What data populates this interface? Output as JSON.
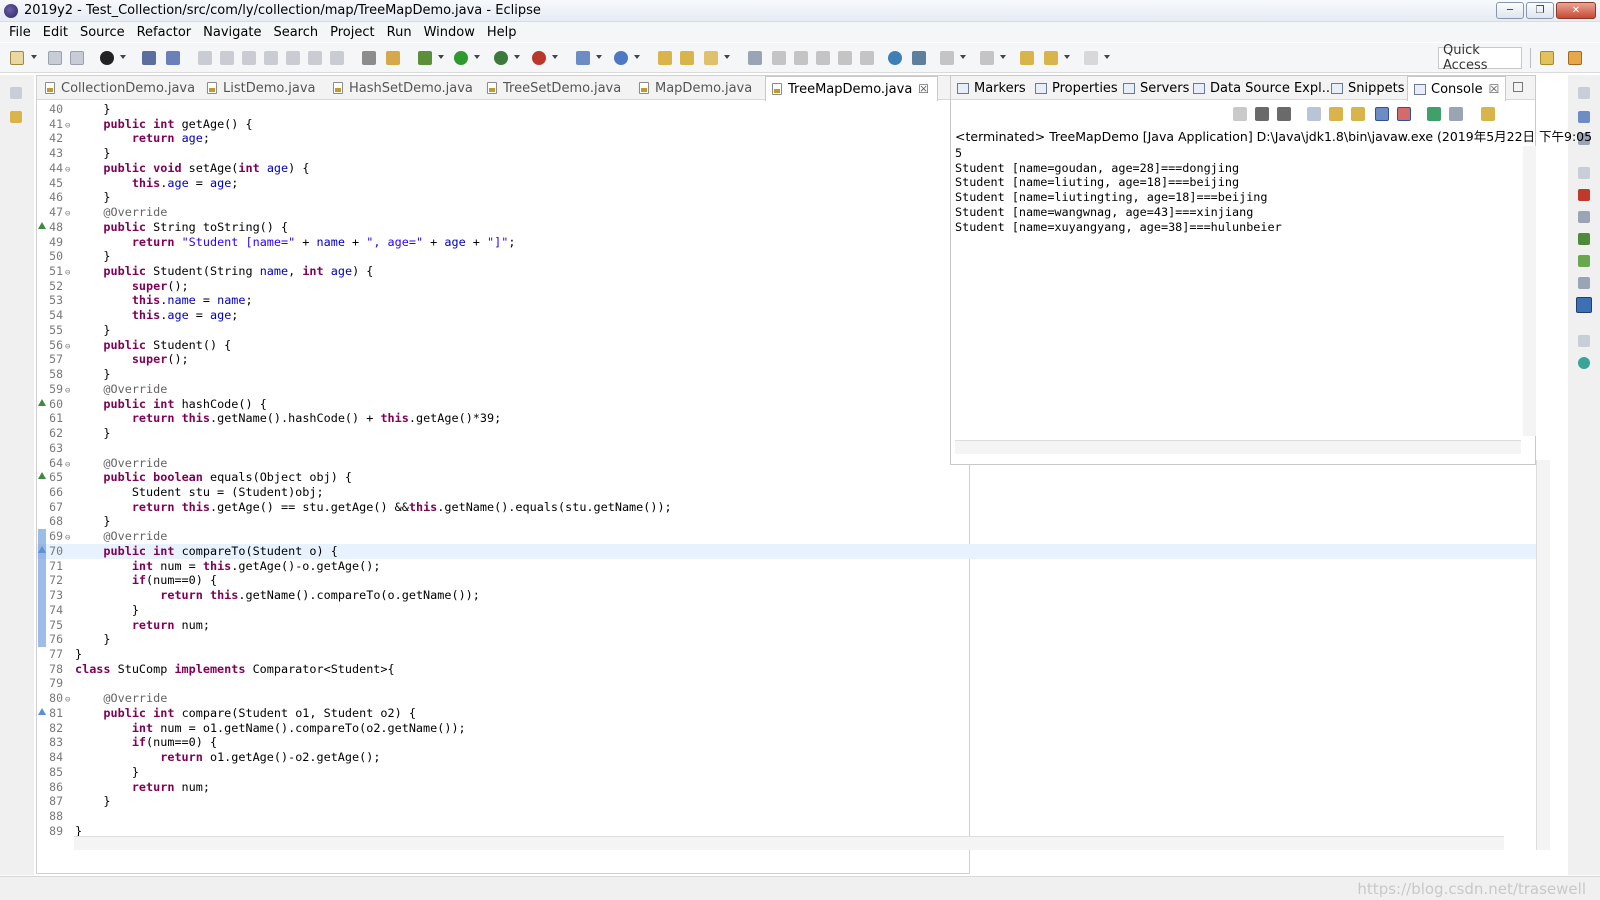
{
  "window": {
    "title": "2019y2 - Test_Collection/src/com/ly/collection/map/TreeMapDemo.java - Eclipse",
    "min_label": "─",
    "max_label": "❐",
    "close_label": "✕"
  },
  "menu": [
    "File",
    "Edit",
    "Source",
    "Refactor",
    "Navigate",
    "Search",
    "Project",
    "Run",
    "Window",
    "Help"
  ],
  "toolbar": {
    "quick_access": "Quick Access"
  },
  "editor": {
    "tabs": [
      {
        "label": "CollectionDemo.java"
      },
      {
        "label": "ListDemo.java"
      },
      {
        "label": "HashSetDemo.java"
      },
      {
        "label": "TreeSetDemo.java"
      },
      {
        "label": "MapDemo.java"
      },
      {
        "label": "TreeMapDemo.java",
        "active": true
      }
    ],
    "close_glyph": "☒",
    "current_line": 70,
    "lines": [
      {
        "n": "40",
        "code": "    }"
      },
      {
        "n": "41",
        "code": "    public int getAge() {",
        "fold": true
      },
      {
        "n": "42",
        "code": "        return age;"
      },
      {
        "n": "43",
        "code": "    }"
      },
      {
        "n": "44",
        "code": "    public void setAge(int age) {",
        "fold": true
      },
      {
        "n": "45",
        "code": "        this.age = age;"
      },
      {
        "n": "46",
        "code": "    }"
      },
      {
        "n": "47",
        "code": "    @Override",
        "fold": true
      },
      {
        "n": "48",
        "code": "    public String toString() {",
        "override": true
      },
      {
        "n": "49",
        "code": "        return \"Student [name=\" + name + \", age=\" + age + \"]\";"
      },
      {
        "n": "50",
        "code": "    }"
      },
      {
        "n": "51",
        "code": "    public Student(String name, int age) {",
        "fold": true
      },
      {
        "n": "52",
        "code": "        super();"
      },
      {
        "n": "53",
        "code": "        this.name = name;"
      },
      {
        "n": "54",
        "code": "        this.age = age;"
      },
      {
        "n": "55",
        "code": "    }"
      },
      {
        "n": "56",
        "code": "    public Student() {",
        "fold": true
      },
      {
        "n": "57",
        "code": "        super();"
      },
      {
        "n": "58",
        "code": "    }"
      },
      {
        "n": "59",
        "code": "    @Override",
        "fold": true
      },
      {
        "n": "60",
        "code": "    public int hashCode() {",
        "override": true
      },
      {
        "n": "61",
        "code": "        return this.getName().hashCode() + this.getAge()*39;"
      },
      {
        "n": "62",
        "code": "    }"
      },
      {
        "n": "63",
        "code": ""
      },
      {
        "n": "64",
        "code": "    @Override",
        "fold": true
      },
      {
        "n": "65",
        "code": "    public boolean equals(Object obj) {",
        "override": true
      },
      {
        "n": "66",
        "code": "        Student stu = (Student)obj;"
      },
      {
        "n": "67",
        "code": "        return this.getAge() == stu.getAge() &&this.getName().equals(stu.getName());"
      },
      {
        "n": "68",
        "code": "    }"
      },
      {
        "n": "69",
        "code": "    @Override",
        "fold": true
      },
      {
        "n": "70",
        "code": "    public int compareTo(Student o) {",
        "impl": true
      },
      {
        "n": "71",
        "code": "        int num = this.getAge()-o.getAge();"
      },
      {
        "n": "72",
        "code": "        if(num==0) {"
      },
      {
        "n": "73",
        "code": "            return this.getName().compareTo(o.getName());"
      },
      {
        "n": "74",
        "code": "        }"
      },
      {
        "n": "75",
        "code": "        return num;"
      },
      {
        "n": "76",
        "code": "    }"
      },
      {
        "n": "77",
        "code": "}"
      },
      {
        "n": "78",
        "code": "class StuComp implements Comparator<Student>{"
      },
      {
        "n": "79",
        "code": ""
      },
      {
        "n": "80",
        "code": "    @Override",
        "fold": true
      },
      {
        "n": "81",
        "code": "    public int compare(Student o1, Student o2) {",
        "impl": true
      },
      {
        "n": "82",
        "code": "        int num = o1.getName().compareTo(o2.getName());"
      },
      {
        "n": "83",
        "code": "        if(num==0) {"
      },
      {
        "n": "84",
        "code": "            return o1.getAge()-o2.getAge();"
      },
      {
        "n": "85",
        "code": "        }"
      },
      {
        "n": "86",
        "code": "        return num;"
      },
      {
        "n": "87",
        "code": "    }"
      },
      {
        "n": "88",
        "code": ""
      },
      {
        "n": "89",
        "code": "}"
      }
    ]
  },
  "views": {
    "tabs": [
      {
        "label": "Markers",
        "icon": "markers-icon"
      },
      {
        "label": "Properties",
        "icon": "properties-icon"
      },
      {
        "label": "Servers",
        "icon": "servers-icon"
      },
      {
        "label": "Data Source Expl...",
        "icon": "data-source-icon"
      },
      {
        "label": "Snippets",
        "icon": "snippets-icon"
      },
      {
        "label": "Console",
        "icon": "console-icon",
        "active": true
      }
    ]
  },
  "console": {
    "header": "<terminated> TreeMapDemo [Java Application] D:\\Java\\jdk1.8\\bin\\javaw.exe (2019年5月22日 下午9:05",
    "output": [
      "5",
      "Student [name=goudan, age=28]===dongjing",
      "Student [name=liuting, age=18]===beijing",
      "Student [name=liutingting, age=18]===beijing",
      "Student [name=wangwnag, age=43]===xinjiang",
      "Student [name=xuyangyang, age=38]===hulunbeier"
    ]
  },
  "status": {
    "watermark": "https://blog.csdn.net/trasewell"
  },
  "colors": {
    "keyword": "#7f0055",
    "string": "#2a00ff",
    "field": "#0000c0",
    "annotation": "#646464",
    "current_line": "#e8f2fe"
  }
}
